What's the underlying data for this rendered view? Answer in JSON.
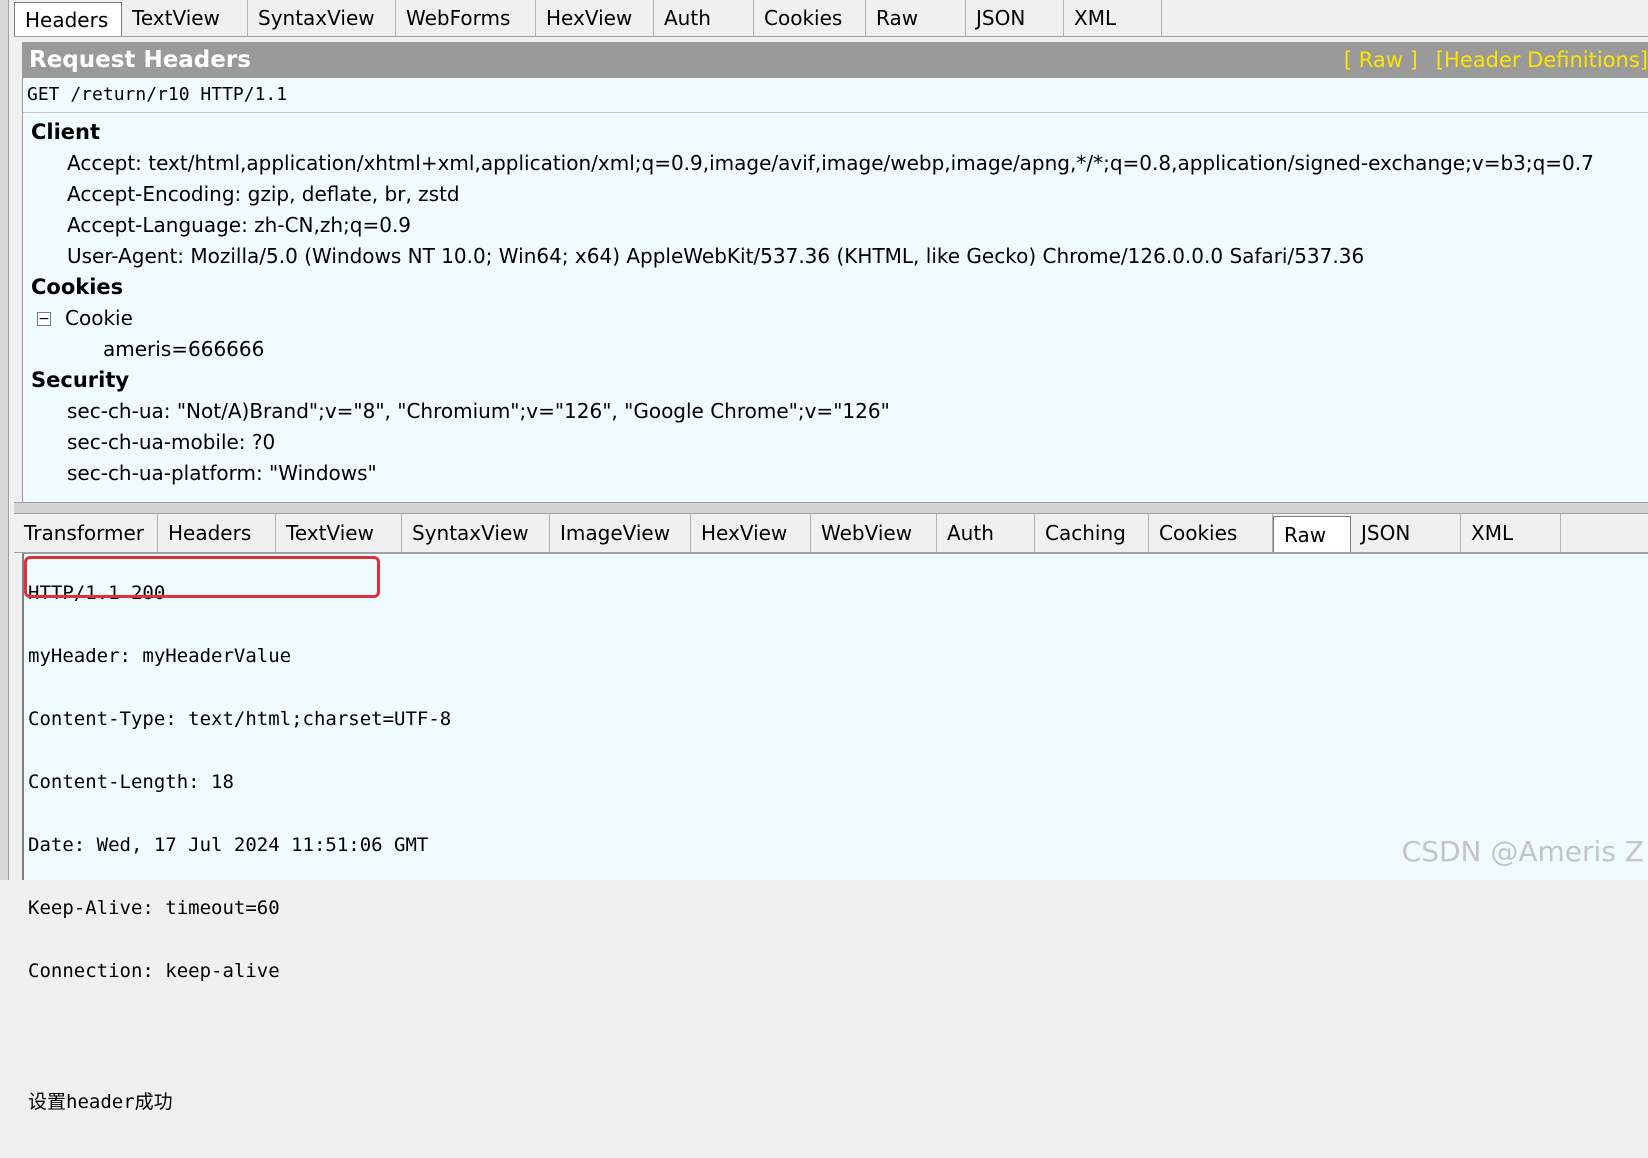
{
  "top_tabs": [
    "Headers",
    "TextView",
    "SyntaxView",
    "WebForms",
    "HexView",
    "Auth",
    "Cookies",
    "Raw",
    "JSON",
    "XML"
  ],
  "request": {
    "title": "Request Headers",
    "raw_link": "[ Raw ]",
    "definitions_link": "[Header Definitions]",
    "request_line": "GET /return/r10 HTTP/1.1",
    "client_label": "Client",
    "client_headers": [
      "Accept: text/html,application/xhtml+xml,application/xml;q=0.9,image/avif,image/webp,image/apng,*/*;q=0.8,application/signed-exchange;v=b3;q=0.7",
      "Accept-Encoding: gzip, deflate, br, zstd",
      "Accept-Language: zh-CN,zh;q=0.9",
      "User-Agent: Mozilla/5.0 (Windows NT 10.0; Win64; x64) AppleWebKit/537.36 (KHTML, like Gecko) Chrome/126.0.0.0 Safari/537.36"
    ],
    "cookies_label": "Cookies",
    "cookie_node": "Cookie",
    "cookie_expander": "−",
    "cookie_value": "ameris=666666",
    "security_label": "Security",
    "security_headers": [
      "sec-ch-ua: \"Not/A)Brand\";v=\"8\", \"Chromium\";v=\"126\", \"Google Chrome\";v=\"126\"",
      "sec-ch-ua-mobile: ?0",
      "sec-ch-ua-platform: \"Windows\""
    ]
  },
  "bottom_tabs": [
    "Transformer",
    "Headers",
    "TextView",
    "SyntaxView",
    "ImageView",
    "HexView",
    "WebView",
    "Auth",
    "Caching",
    "Cookies",
    "Raw",
    "JSON",
    "XML"
  ],
  "response": {
    "lines": [
      "HTTP/1.1 200",
      "myHeader: myHeaderValue",
      "Content-Type: text/html;charset=UTF-8",
      "Content-Length: 18",
      "Date: Wed, 17 Jul 2024 11:51:06 GMT",
      "Keep-Alive: timeout=60",
      "Connection: keep-alive"
    ],
    "body": "设置header成功"
  },
  "watermark": "CSDN @Ameris Z",
  "colors": {
    "pane_bg": "#f0fbff",
    "title_bar": "#9a9a9a",
    "link_yellow": "#ffe400",
    "highlight_red": "#e0303a"
  }
}
